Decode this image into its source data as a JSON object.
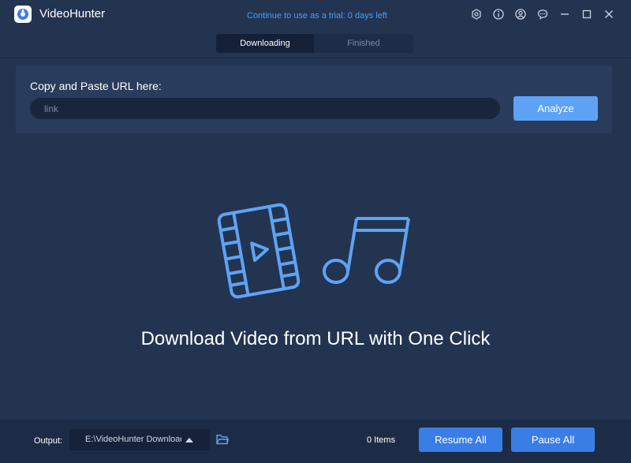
{
  "app": {
    "title": "VideoHunter",
    "trial_notice": "Continue to use as a trial: 0 days left"
  },
  "window_controls": [
    "settings-icon",
    "info-icon",
    "account-icon",
    "feedback-icon",
    "minimize-icon",
    "maximize-icon",
    "close-icon"
  ],
  "tabs": [
    {
      "label": "Downloading",
      "active": true
    },
    {
      "label": "Finished",
      "active": false
    }
  ],
  "url_panel": {
    "label": "Copy and Paste URL here:",
    "input_value": "",
    "input_placeholder": "link",
    "analyze_label": "Analyze"
  },
  "hero": {
    "text": "Download Video from URL with One Click",
    "icons": [
      "video-film-icon",
      "music-note-icon"
    ]
  },
  "footer": {
    "output_label": "Output:",
    "output_path": "E:\\VideoHunter Download",
    "items_count": "0 Items",
    "resume_label": "Resume All",
    "pause_label": "Pause All"
  },
  "colors": {
    "background": "#233451",
    "accent": "#5ea3f5",
    "button": "#3a7de6",
    "trial_text": "#4b9cf5"
  }
}
